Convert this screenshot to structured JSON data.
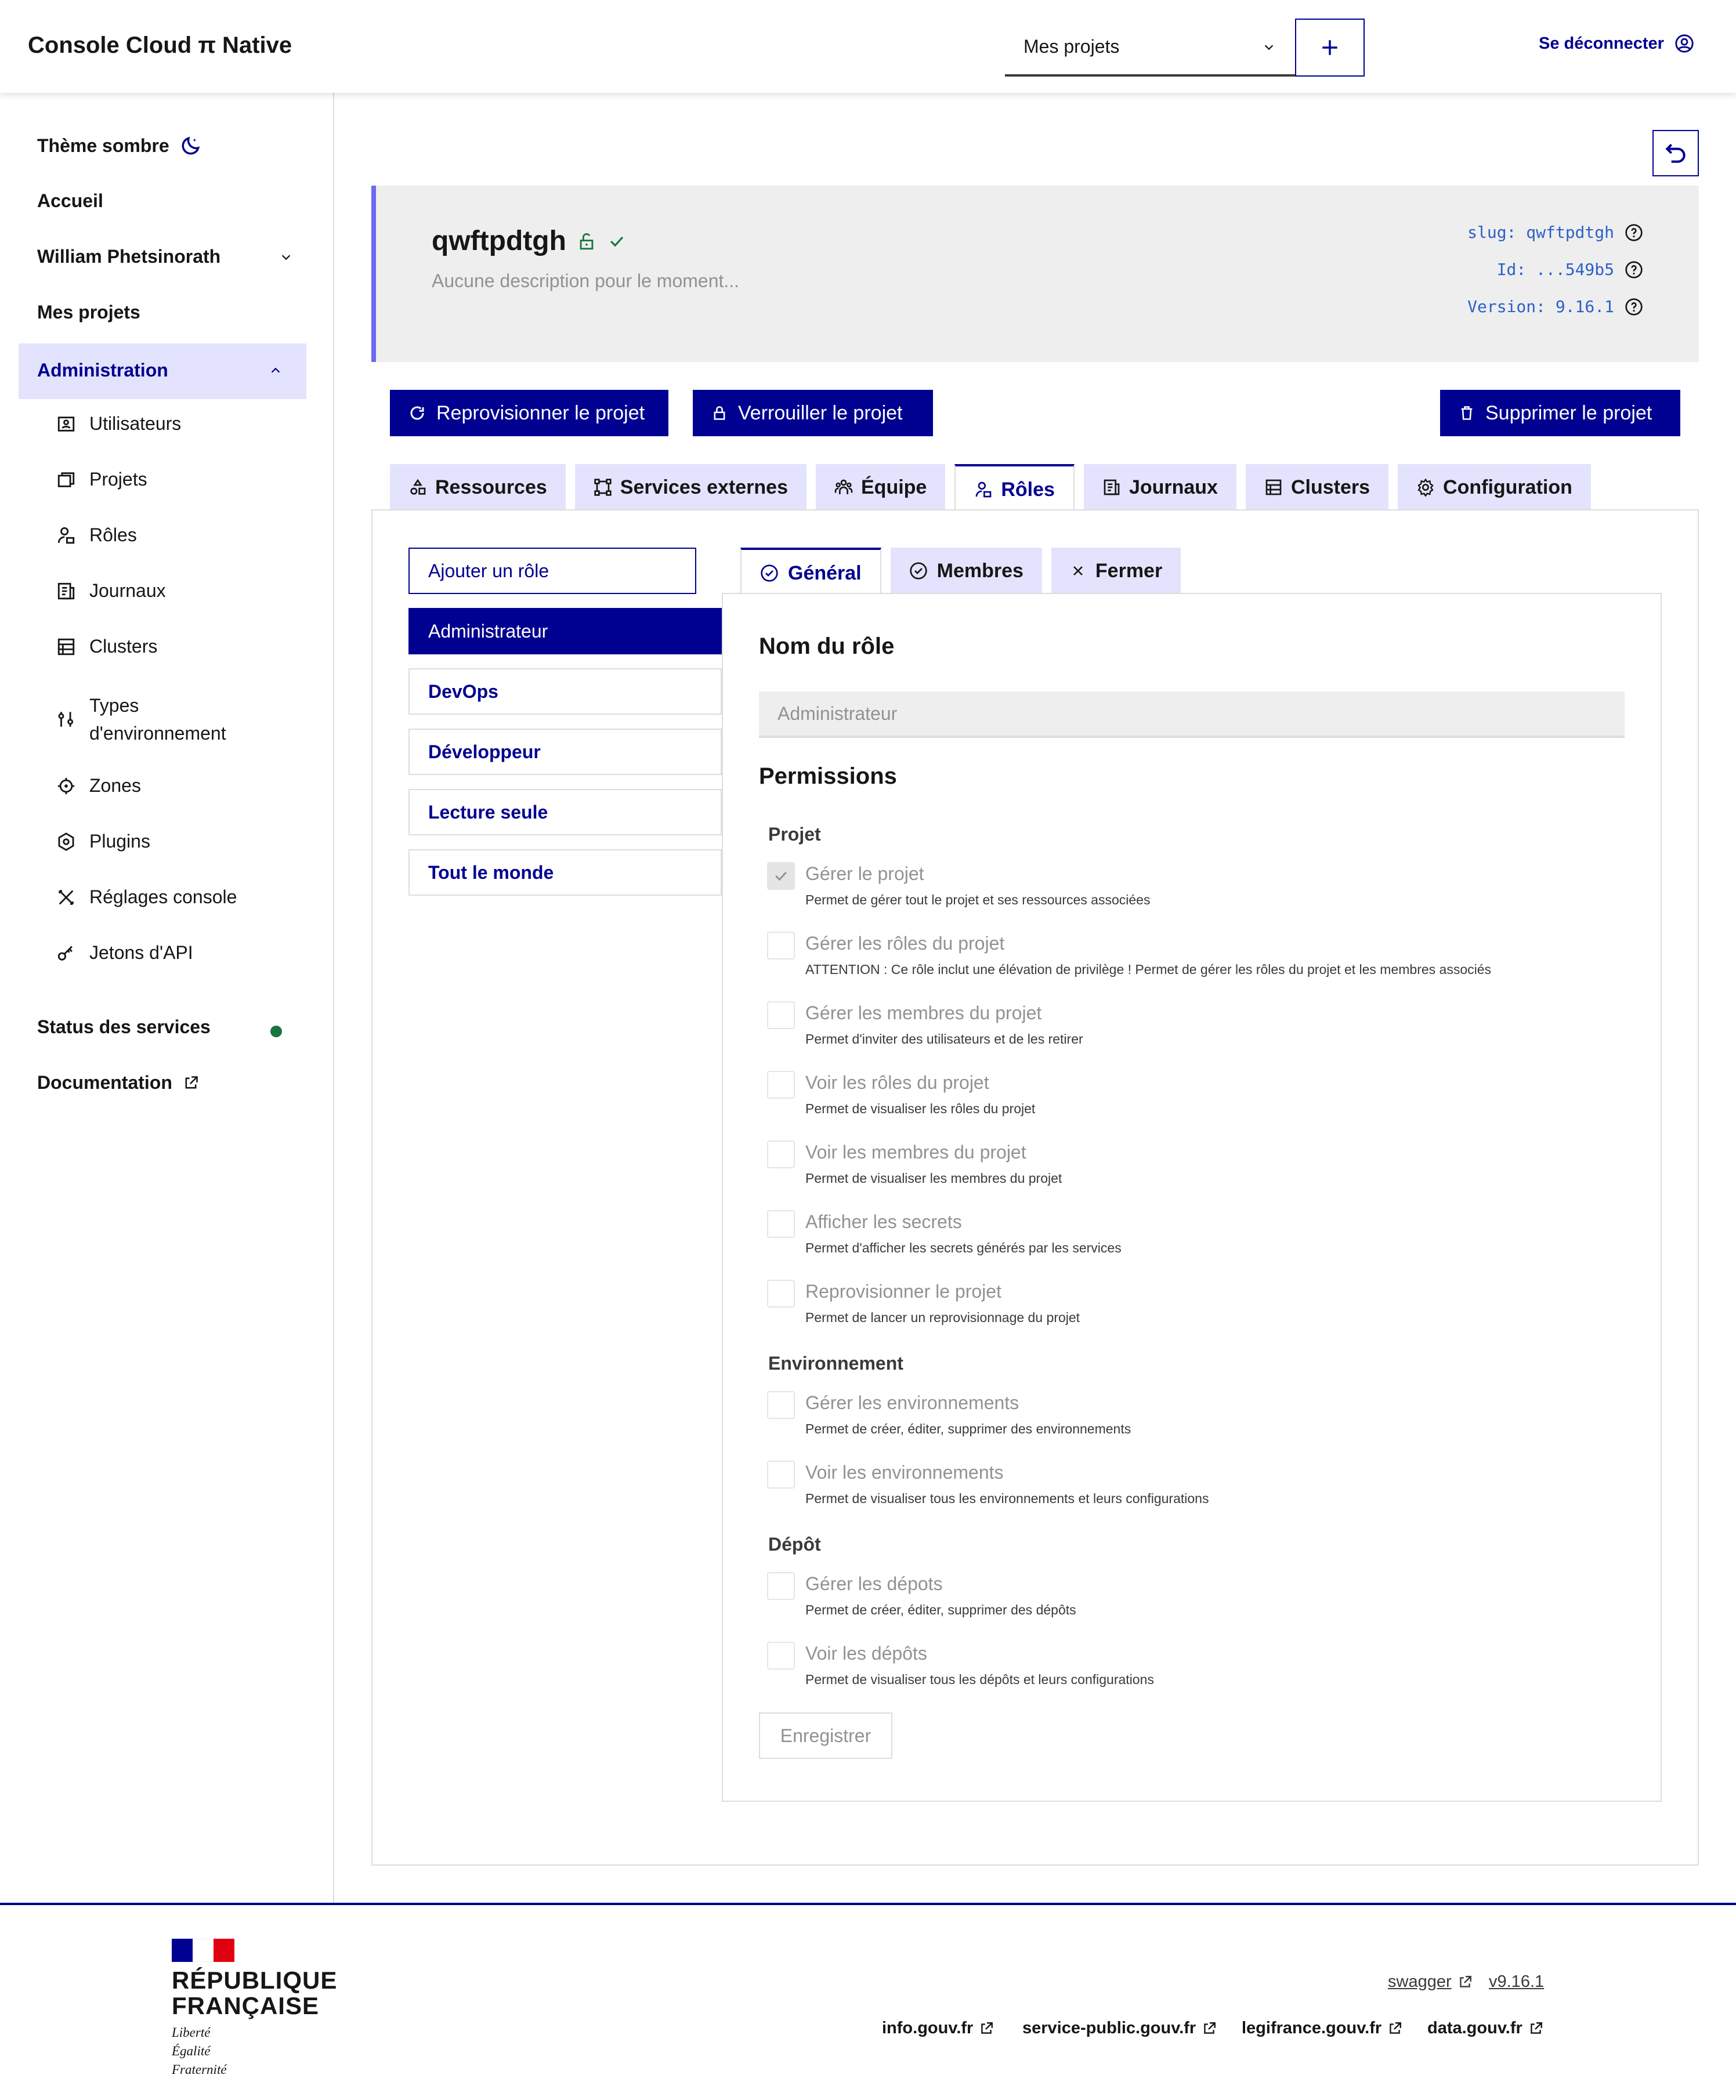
{
  "header": {
    "brand": "Console Cloud π Native",
    "project_select": "Mes projets",
    "logout": "Se déconnecter"
  },
  "sidebar": {
    "theme": "Thème sombre",
    "home": "Accueil",
    "user": "William Phetsinorath",
    "my_projects": "Mes projets",
    "admin": "Administration",
    "admin_items": [
      {
        "label": "Utilisateurs",
        "icon": "users-icon"
      },
      {
        "label": "Projets",
        "icon": "projects-icon"
      },
      {
        "label": "Rôles",
        "icon": "roles-icon"
      },
      {
        "label": "Journaux",
        "icon": "logs-icon"
      },
      {
        "label": "Clusters",
        "icon": "clusters-icon"
      },
      {
        "label": "Types",
        "label2": "d'environnement",
        "icon": "env-types-icon"
      },
      {
        "label": "Zones",
        "icon": "zones-icon"
      },
      {
        "label": "Plugins",
        "icon": "plugins-icon"
      },
      {
        "label": "Réglages console",
        "icon": "settings-icon"
      },
      {
        "label": "Jetons d'API",
        "icon": "key-icon"
      }
    ],
    "services_status": "Status des services",
    "documentation": "Documentation"
  },
  "project": {
    "name": "qwftpdtgh",
    "description": "Aucune description pour le moment...",
    "slug": "slug: qwftpdtgh",
    "id": "Id: ...549b5",
    "version": "Version: 9.16.1"
  },
  "actions": {
    "reprovision": "Reprovisionner le projet",
    "lock": "Verrouiller le projet",
    "delete": "Supprimer le projet"
  },
  "tabs": [
    "Ressources",
    "Services externes",
    "Équipe",
    "Rôles",
    "Journaux",
    "Clusters",
    "Configuration"
  ],
  "roles": {
    "add": "Ajouter un rôle",
    "list": [
      "Administrateur",
      "DevOps",
      "Développeur",
      "Lecture seule",
      "Tout le monde"
    ],
    "subtabs": [
      "Général",
      "Membres",
      "Fermer"
    ],
    "name_title": "Nom du rôle",
    "name_value": "Administrateur",
    "permissions_title": "Permissions",
    "groups": [
      "Projet",
      "Environnement",
      "Dépôt"
    ],
    "permissions": [
      {
        "label": "Gérer le projet",
        "help": "Permet de gérer tout le projet et ses ressources associées",
        "checked": true
      },
      {
        "label": "Gérer les rôles du projet",
        "help": "ATTENTION : Ce rôle inclut une élévation de privilège ! Permet de gérer les rôles du projet et les membres associés",
        "checked": false
      },
      {
        "label": "Gérer les membres du projet",
        "help": "Permet d'inviter des utilisateurs et de les retirer",
        "checked": false
      },
      {
        "label": "Voir les rôles du projet",
        "help": "Permet de visualiser les rôles du projet",
        "checked": false
      },
      {
        "label": "Voir les membres du projet",
        "help": "Permet de visualiser les membres du projet",
        "checked": false
      },
      {
        "label": "Afficher les secrets",
        "help": "Permet d'afficher les secrets générés par les services",
        "checked": false
      },
      {
        "label": "Reprovisionner le projet",
        "help": "Permet de lancer un reprovisionnage du projet",
        "checked": false
      },
      {
        "label": "Gérer les environnements",
        "help": "Permet de créer, éditer, supprimer des environnements",
        "checked": false
      },
      {
        "label": "Voir les environnements",
        "help": "Permet de visualiser tous les environnements et leurs configurations",
        "checked": false
      },
      {
        "label": "Gérer les dépots",
        "help": "Permet de créer, éditer, supprimer des dépôts",
        "checked": false
      },
      {
        "label": "Voir les dépôts",
        "help": "Permet de visualiser tous les dépôts et leurs configurations",
        "checked": false
      }
    ],
    "save": "Enregistrer"
  },
  "footer": {
    "rf_line1": "RÉPUBLIQUE",
    "rf_line2": "FRANÇAISE",
    "devise": [
      "Liberté",
      "Égalité",
      "Fraternité"
    ],
    "swagger": "swagger",
    "version": "v9.16.1",
    "links": [
      "info.gouv.fr",
      "service-public.gouv.fr",
      "legifrance.gouv.fr",
      "data.gouv.fr"
    ]
  },
  "colors": {
    "primary": "#000091",
    "accent_border": "#6a6af4",
    "status_ok": "#18753c",
    "meta_blue": "#2b60c8"
  }
}
